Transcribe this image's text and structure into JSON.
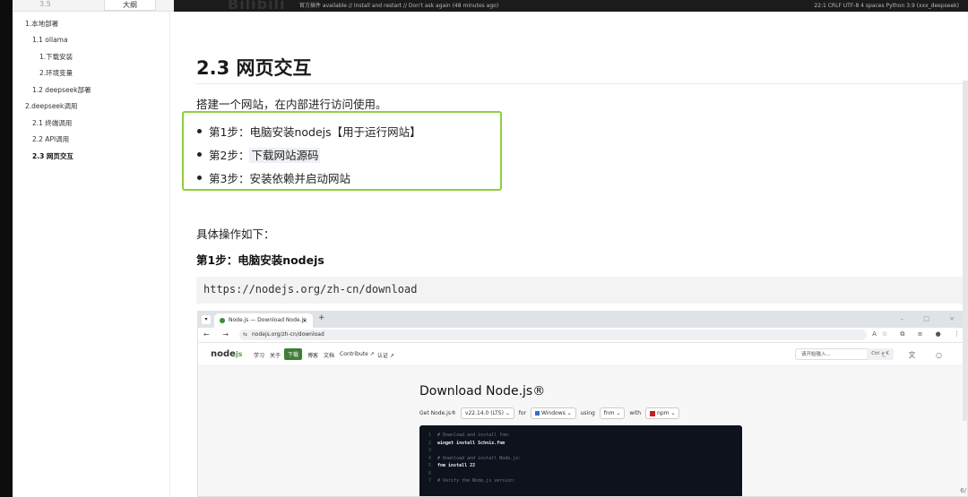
{
  "topbar": {
    "left_text": "3.5",
    "tab_label": "大纲",
    "logo": "Bilibili",
    "status_message": "官方插件 available // Install and restart // Don't ask again (48 minutes ago)",
    "status_right": "22:1   CRLF   UTF-8   4 spaces   Python 3.9 (xxx_deepseek)"
  },
  "sidebar": {
    "items": [
      {
        "label": "1.本地部署",
        "level": 0
      },
      {
        "label": "1.1 ollama",
        "level": 1
      },
      {
        "label": "1.下载安装",
        "level": 2
      },
      {
        "label": "2.环境变量",
        "level": 2
      },
      {
        "label": "1.2 deepseek部署",
        "level": 1
      },
      {
        "label": "2.deepseek调用",
        "level": 0
      },
      {
        "label": "2.1 终端调用",
        "level": 1
      },
      {
        "label": "2.2 API调用",
        "level": 1
      },
      {
        "label": "2.3 网页交互",
        "level": 1,
        "active": true
      }
    ],
    "bottom_controls": "‹  </>"
  },
  "content": {
    "heading": "2.3 网页交互",
    "intro": "搭建一个网站，在内部进行访问使用。",
    "steps": [
      {
        "prefix": "第1步：",
        "text": "电脑安装nodejs【用于运行网站】",
        "highlight": false
      },
      {
        "prefix": "第2步：",
        "text": "下载网站源码",
        "highlight": true
      },
      {
        "prefix": "第3步：",
        "text": "安装依赖并启动网站",
        "highlight": false
      }
    ],
    "detail_label": "具体操作如下：",
    "step1_heading": "第1步：电脑安装nodejs",
    "code": "https://nodejs.org/zh-cn/download"
  },
  "browser": {
    "tab_title": "Node.js — Download Node.js",
    "new_tab": "+",
    "window_controls": "– □ ×",
    "nav_buttons": "← → C",
    "url": "nodejs.org/zh-cn/download",
    "toolbar_icons": "A☆ ⧉ ≡ ● ⋮",
    "logo": "node",
    "logo_suffix": "js",
    "nav_links": [
      "学习",
      "关于",
      "下载",
      "博客",
      "文档",
      "Contribute ↗",
      "认证 ↗"
    ],
    "active_nav": "下载",
    "search_placeholder": "请开始输入...",
    "search_shortcut": "Ctrl + K",
    "right_icons": "☾ 文 ○",
    "download_title": "Download Node.js®",
    "get_label": "Get Node.js®",
    "version": "v22.14.0 (LTS)",
    "for_label": "for",
    "os": "Windows",
    "using_label": "using",
    "manager": "fnm",
    "with_label": "with",
    "pkg": "npm",
    "terminal_lines": [
      {
        "n": "1",
        "text": "# Download and install fnm:",
        "kind": "comment"
      },
      {
        "n": "2",
        "text": "winget install Schniz.fnm",
        "kind": "cmd"
      },
      {
        "n": "3",
        "text": "",
        "kind": "blank"
      },
      {
        "n": "4",
        "text": "# Download and install Node.js:",
        "kind": "comment"
      },
      {
        "n": "5",
        "text": "fnm install 22",
        "kind": "cmd"
      },
      {
        "n": "6",
        "text": "",
        "kind": "blank"
      },
      {
        "n": "7",
        "text": "# Verify the Node.js version:",
        "kind": "comment"
      }
    ]
  },
  "page_counter": "6/"
}
